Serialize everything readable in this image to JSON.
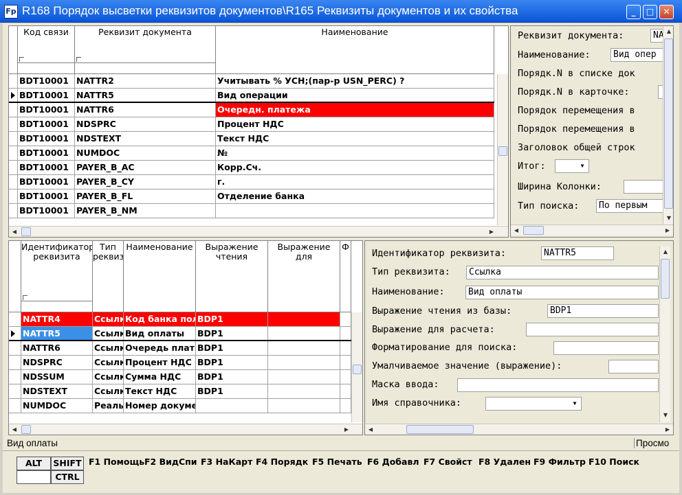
{
  "window": {
    "title": "R168 Порядок высветки реквизитов документов\\R165 Реквизиты документов и их свойства",
    "icon": "Fp"
  },
  "top_grid": {
    "headers": [
      "Код связи",
      "Реквизит документа",
      "Наименование"
    ],
    "rows": [
      {
        "code": "BDT10001",
        "attr": "NATTR2",
        "name": "Учитывать % УСН;(пар-р USN_PERC) ?"
      },
      {
        "code": "BDT10001",
        "attr": "NATTR5",
        "name": "Вид операции"
      },
      {
        "code": "BDT10001",
        "attr": "NATTR6",
        "name": "Очередн. платежа"
      },
      {
        "code": "BDT10001",
        "attr": "NDSPRC",
        "name": "Процент НДС"
      },
      {
        "code": "BDT10001",
        "attr": "NDSTEXT",
        "name": "Текст  НДС"
      },
      {
        "code": "BDT10001",
        "attr": "NUMDOC",
        "name": "№"
      },
      {
        "code": "BDT10001",
        "attr": "PAYER_B_AC",
        "name": "Корр.Сч."
      },
      {
        "code": "BDT10001",
        "attr": "PAYER_B_CY",
        "name": "г."
      },
      {
        "code": "BDT10001",
        "attr": "PAYER_B_FL",
        "name": "Отделение банка"
      },
      {
        "code": "BDT10001",
        "attr": "PAYER_B_NM",
        "name": ""
      }
    ]
  },
  "top_form": {
    "labels": {
      "attr": "Реквизит документа:",
      "name": "Наименование:",
      "order_list": "Порядк.N в списке док",
      "order_card": "Порядк.N в карточке:",
      "move1": "Порядок перемещения в",
      "move2": "Порядок перемещения в",
      "group_header": "Заголовок общей строк",
      "total": "Итог:",
      "col_width": "Ширина Колонки:",
      "search_type": "Тип поиска:"
    },
    "values": {
      "attr": "NA",
      "name": "Вид опер",
      "search_type": "По первым"
    }
  },
  "bottom_grid": {
    "headers": [
      "Идентификатор реквизита",
      "Тип реквизита",
      "Наименование",
      "Выражение чтения",
      "Выражение для",
      "Ф"
    ],
    "rows": [
      {
        "id": "NATTR4",
        "type": "Ссылка",
        "name": "Код банка пол",
        "expr": "BDP1"
      },
      {
        "id": "NATTR5",
        "type": "Ссылка",
        "name": "Вид оплаты",
        "expr": "BDP1"
      },
      {
        "id": "NATTR6",
        "type": "Ссылка",
        "name": "Очередь плат",
        "expr": "BDP1"
      },
      {
        "id": "NDSPRC",
        "type": "Ссылка",
        "name": "Процент НДС",
        "expr": "BDP1"
      },
      {
        "id": "NDSSUM",
        "type": "Ссылка",
        "name": "Сумма НДС",
        "expr": "BDP1"
      },
      {
        "id": "NDSTEXT",
        "type": "Ссылка",
        "name": "Текст  НДС",
        "expr": "BDP1"
      },
      {
        "id": "NUMDOC",
        "type": "Реальное",
        "name": "Номер докуме",
        "expr": ""
      }
    ]
  },
  "bottom_form": {
    "labels": {
      "id": "Идентификатор реквизита:",
      "type": "Тип реквизита:",
      "name": "Наименование:",
      "read_expr": "Выражение чтения из базы:",
      "calc_expr": "Выражение для расчета:",
      "search_fmt": "Форматирование для поиска:",
      "default_expr": "Умалчиваемое значение (выражение):",
      "input_mask": "Маска ввода:",
      "ref_name": "Имя справочника:"
    },
    "values": {
      "id": "NATTR5",
      "type": "Ссылка",
      "name": "Вид оплаты",
      "read_expr": "BDP1"
    }
  },
  "status": {
    "left": "Вид оплаты",
    "right": "Просмо"
  },
  "keys": {
    "alt": "ALT",
    "shift": "SHIFT",
    "ctrl": "CTRL",
    "f1": "F1 Помощь",
    "f2": "F2 ВидСпи",
    "f3": "F3 НаКарт",
    "f4": "F4 Порядк",
    "f5": "F5 Печать",
    "f6": "F6 Добавл",
    "f7": "F7 Свойст",
    "f8": "F8 Удален",
    "f9": "F9 Фильтр",
    "f10": "F10 Поиск"
  }
}
